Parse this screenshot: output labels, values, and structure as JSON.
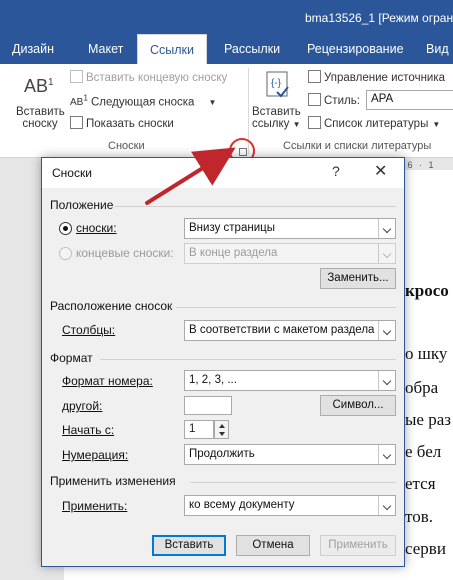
{
  "window": {
    "title": "bma13526_1 [Режим огран"
  },
  "tabs": [
    {
      "label": "Дизайн"
    },
    {
      "label": "Макет"
    },
    {
      "label": "Ссылки",
      "active": true
    },
    {
      "label": "Рассылки"
    },
    {
      "label": "Рецензирование"
    },
    {
      "label": "Вид"
    }
  ],
  "ribbon": {
    "footnotes": {
      "insert_footnote_icon": "AB",
      "insert_footnote_sup": "1",
      "insert_footnote_line1": "Вставить",
      "insert_footnote_line2": "сноску",
      "insert_endnote": "Вставить концевую сноску",
      "next_footnote_icon": "AB",
      "next_footnote_sup": "1",
      "next_footnote": "Следующая сноска",
      "show_notes": "Показать сноски",
      "group_label": "Сноски"
    },
    "citations": {
      "insert_citation_line1": "Вставить",
      "insert_citation_line2": "ссылку",
      "manage_sources": "Управление источника",
      "style_label": "Стиль:",
      "style_value": "APA",
      "bibliography": "Список литературы",
      "group_label": "Ссылки и списки литературы"
    }
  },
  "document": {
    "lines": [
      "кросо",
      "о шку",
      "обра",
      "ые раз",
      "е бел",
      "ется",
      "тов.",
      "серви"
    ],
    "ruler": "· 6 · 1"
  },
  "dialog": {
    "title": "Сноски",
    "help": "?",
    "close": "✕",
    "position": {
      "section_title": "Положение",
      "footnotes_label": "сноски:",
      "footnotes_value": "Внизу страницы",
      "endnotes_label": "концевые сноски:",
      "endnotes_value": "В конце раздела",
      "convert_button": "Заменить..."
    },
    "layout": {
      "section_title": "Расположение сносок",
      "columns_label": "Столбцы:",
      "columns_value": "В соответствии с макетом раздела"
    },
    "format": {
      "section_title": "Формат",
      "number_format_label": "Формат номера:",
      "number_format_value": "1, 2, 3, ...",
      "custom_mark_label": "другой:",
      "custom_mark_value": "",
      "symbol_button": "Символ...",
      "start_at_label": "Начать с:",
      "start_at_value": "1",
      "numbering_label": "Нумерация:",
      "numbering_value": "Продолжить"
    },
    "apply": {
      "section_title": "Применить изменения",
      "apply_to_label": "Применить:",
      "apply_to_value": "ко всему документу"
    },
    "buttons": {
      "insert": "Вставить",
      "cancel": "Отмена",
      "apply": "Применить"
    }
  },
  "colors": {
    "accent": "#2b579a",
    "annotation_arrow": "#c0272d"
  }
}
